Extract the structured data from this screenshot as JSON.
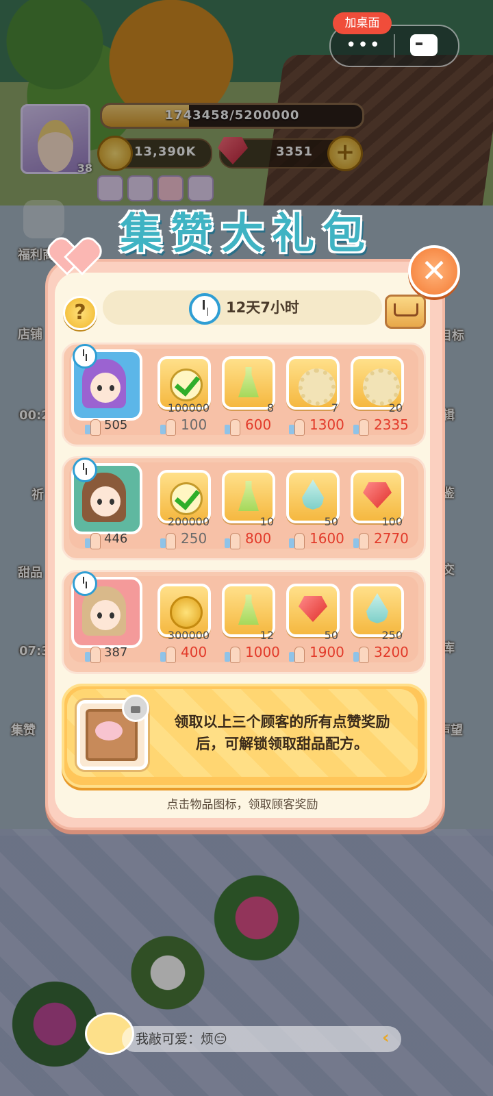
{
  "system": {
    "add_to_desktop": "加桌面",
    "more_dots": "•••"
  },
  "hud": {
    "level": "38",
    "exp_text": "1743458/5200000",
    "exp_progress": 0.335,
    "coins": "13,390K",
    "gems": "3351",
    "plus": "+"
  },
  "side_menu": {
    "left": [
      "福利商",
      "店铺",
      "00:2",
      "祈",
      "甜品",
      "07:3",
      "集赞"
    ],
    "right": [
      "目标",
      "辑",
      "鉴",
      "交",
      "库",
      "声望"
    ]
  },
  "popup": {
    "title": "集赞大礼包",
    "close": "✕",
    "help": "?",
    "timer": "12天7小时",
    "customers": [
      {
        "likes": "505",
        "hair_color": "#9b63d1",
        "bg_color": "#5cb6e8",
        "rewards": [
          {
            "icon": "check-icon",
            "qty": "100000",
            "like": "100",
            "claimed": true
          },
          {
            "icon": "potion-icon",
            "qty": "8",
            "like": "600",
            "claimed": false
          },
          {
            "icon": "gear-icon",
            "qty": "7",
            "like": "1300",
            "claimed": false
          },
          {
            "icon": "gear-icon",
            "qty": "20",
            "like": "2335",
            "claimed": false
          }
        ]
      },
      {
        "likes": "446",
        "hair_color": "#8a5a3a",
        "bg_color": "#5fb8a0",
        "rewards": [
          {
            "icon": "check-icon",
            "qty": "200000",
            "like": "250",
            "claimed": true
          },
          {
            "icon": "potion-icon",
            "qty": "10",
            "like": "800",
            "claimed": false
          },
          {
            "icon": "drop-icon",
            "qty": "50",
            "like": "1600",
            "claimed": false
          },
          {
            "icon": "ruby-icon",
            "qty": "100",
            "like": "2770",
            "claimed": false
          }
        ]
      },
      {
        "likes": "387",
        "hair_color": "#d9b98a",
        "bg_color": "#f49a9a",
        "rewards": [
          {
            "icon": "coin-icon",
            "qty": "300000",
            "like": "400",
            "claimed": false
          },
          {
            "icon": "potion-icon",
            "qty": "12",
            "like": "1000",
            "claimed": false
          },
          {
            "icon": "ruby-icon",
            "qty": "50",
            "like": "1900",
            "claimed": false
          },
          {
            "icon": "drop-icon",
            "qty": "250",
            "like": "3200",
            "claimed": false
          }
        ]
      }
    ],
    "recipe_line1": "领取以上三个顾客的所有点赞奖励",
    "recipe_line2": "后，可解锁领取甜品配方。",
    "hint": "点击物品图标，领取顾客奖励"
  },
  "chat": {
    "text": "我敲可爱：烦😑",
    "arrow": "‹"
  }
}
